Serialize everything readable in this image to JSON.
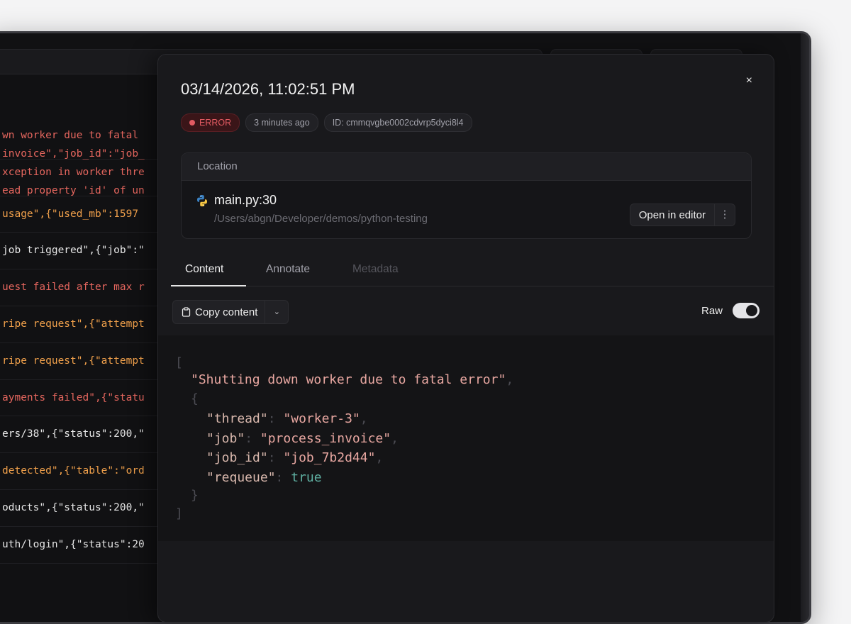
{
  "log_rows": [
    {
      "lines": [
        "wn worker due to fatal",
        "invoice\",\"job_id\":\"job_"
      ],
      "color": "red"
    },
    {
      "lines": [
        "xception in worker thre",
        "ead property 'id' of un"
      ],
      "color": "red"
    },
    {
      "lines": [
        " usage\",{\"used_mb\":1597"
      ],
      "color": "orange"
    },
    {
      "lines": [
        "job triggered\",{\"job\":\""
      ],
      "color": "white"
    },
    {
      "lines": [
        "uest failed after max r"
      ],
      "color": "red"
    },
    {
      "lines": [
        "ripe request\",{\"attempt"
      ],
      "color": "orange"
    },
    {
      "lines": [
        "ripe request\",{\"attempt"
      ],
      "color": "orange"
    },
    {
      "lines": [
        "ayments failed\",{\"statu"
      ],
      "color": "red"
    },
    {
      "lines": [
        "ers/38\",{\"status\":200,\""
      ],
      "color": "white"
    },
    {
      "lines": [
        "detected\",{\"table\":\"ord"
      ],
      "color": "orange"
    },
    {
      "lines": [
        "oducts\",{\"status\":200,\""
      ],
      "color": "white"
    },
    {
      "lines": [
        "uth/login\",{\"status\":20"
      ],
      "color": "white"
    }
  ],
  "detail": {
    "timestamp": "03/14/2026, 11:02:51 PM",
    "close_glyph": "×",
    "level_badge": "ERROR",
    "relative_time": "3 minutes ago",
    "id_badge": "ID: cmmqvgbe0002cdvrp5dyci8l4",
    "location": {
      "header": "Location",
      "file": "main.py:30",
      "path": "/Users/abgn/Developer/demos/python-testing",
      "open_editor_label": "Open in editor",
      "more_glyph": "⋮"
    },
    "tabs": {
      "content": "Content",
      "annotate": "Annotate",
      "metadata": "Metadata"
    },
    "toolbar": {
      "copy_label": "Copy content",
      "caret_glyph": "⌄",
      "raw_label": "Raw",
      "raw_enabled": true
    },
    "code": {
      "open_bracket": "[",
      "message": "\"Shutting down worker due to fatal error\"",
      "open_brace": "{",
      "fields": [
        {
          "key": "\"thread\"",
          "value": "\"worker-3\"",
          "type": "string"
        },
        {
          "key": "\"job\"",
          "value": "\"process_invoice\"",
          "type": "string"
        },
        {
          "key": "\"job_id\"",
          "value": "\"job_7b2d44\"",
          "type": "string"
        },
        {
          "key": "\"requeue\"",
          "value": "true",
          "type": "bool"
        }
      ],
      "close_brace": "}",
      "close_bracket": "]"
    }
  },
  "colors": {
    "error": "#e35b62",
    "log_red": "#e5665e",
    "log_orange": "#f0a04b",
    "json_string": "#e8a7a1",
    "json_bool": "#5fb0a2"
  }
}
